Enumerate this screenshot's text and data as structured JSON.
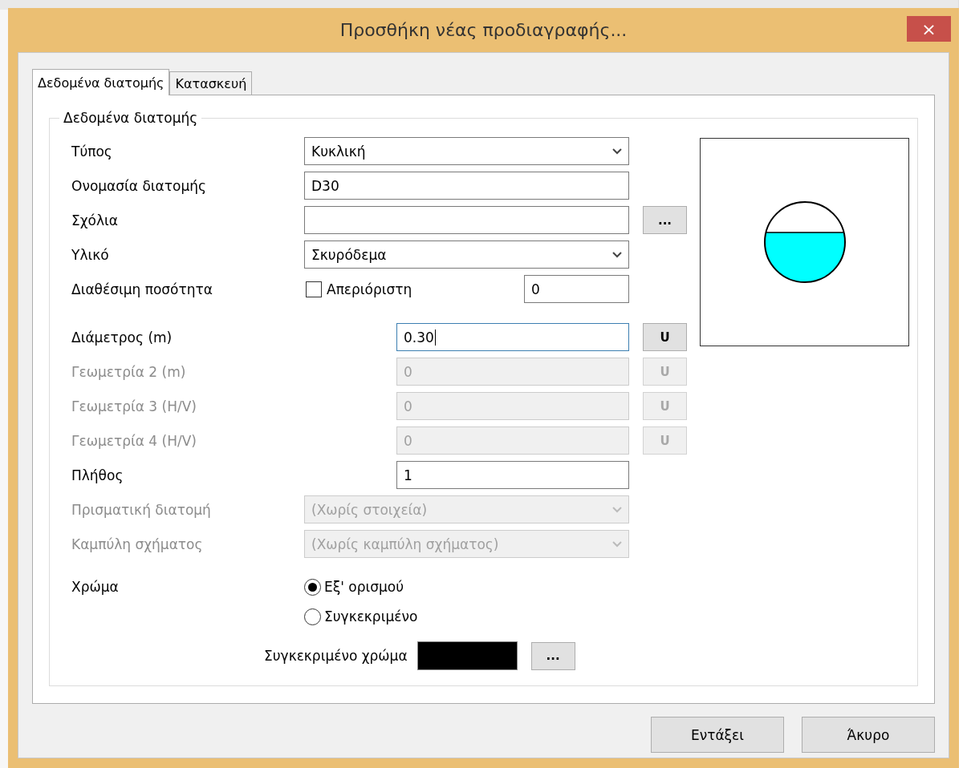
{
  "window": {
    "title": "Προσθήκη νέας προδιαγραφής...",
    "close": "×"
  },
  "tabs": [
    {
      "label": "Δεδομένα διατομής",
      "selected": true
    },
    {
      "label": "Κατασκευή",
      "selected": false
    }
  ],
  "group": {
    "title": "Δεδομένα διατομής"
  },
  "fields": [
    {
      "kind": "select",
      "label": "Τύπος",
      "value": "Κυκλική",
      "disabled": false,
      "focused": false
    },
    {
      "kind": "text",
      "label": "Ονομασία διατομής",
      "value": "D30",
      "disabled": false,
      "focused": false
    },
    {
      "kind": "text-more",
      "label": "Σχόλια",
      "button": "...",
      "disabled": false,
      "focused": false
    },
    {
      "kind": "select",
      "label": "Υλικό",
      "value": "Σκυρόδεμα",
      "disabled": false,
      "focused": false
    },
    {
      "kind": "checkbox-number",
      "label": "Διαθέσιμη ποσότητα",
      "check_label": "Απεριόριστη",
      "checked": false,
      "value": "0",
      "disabled": false,
      "focused": false
    },
    {
      "kind": "measure",
      "label": "Διάμετρος (m)",
      "value": "0.30",
      "button": "U",
      "disabled": false,
      "focused": true
    },
    {
      "kind": "measure",
      "label": "Γεωμετρία 2 (m)",
      "value": "0",
      "button": "U",
      "disabled": true,
      "focused": false
    },
    {
      "kind": "measure",
      "label": "Γεωμετρία 3 (H/V)",
      "value": "0",
      "button": "U",
      "disabled": true,
      "focused": false
    },
    {
      "kind": "measure",
      "label": "Γεωμετρία 4 (H/V)",
      "value": "0",
      "button": "U",
      "disabled": true,
      "focused": false
    },
    {
      "kind": "text-short",
      "label": "Πλήθος",
      "value": "1",
      "disabled": false,
      "focused": false
    },
    {
      "kind": "select",
      "label": "Πρισματική διατομή",
      "value": "(Χωρίς στοιχεία)",
      "disabled": true,
      "focused": false
    },
    {
      "kind": "select",
      "label": "Καμπύλη σχήματος",
      "value": "(Χωρίς καμπύλη σχήματος)",
      "disabled": true,
      "focused": false
    }
  ],
  "color": {
    "label": "Χρώμα",
    "options": [
      {
        "label": "Εξ' ορισμού",
        "selected": true
      },
      {
        "label": "Συγκεκριμένο",
        "selected": false
      }
    ],
    "custom_label": "Συγκεκριμένο χρώμα",
    "button": "..."
  },
  "buttons": [
    "Εντάξει",
    "Άκυρο"
  ]
}
